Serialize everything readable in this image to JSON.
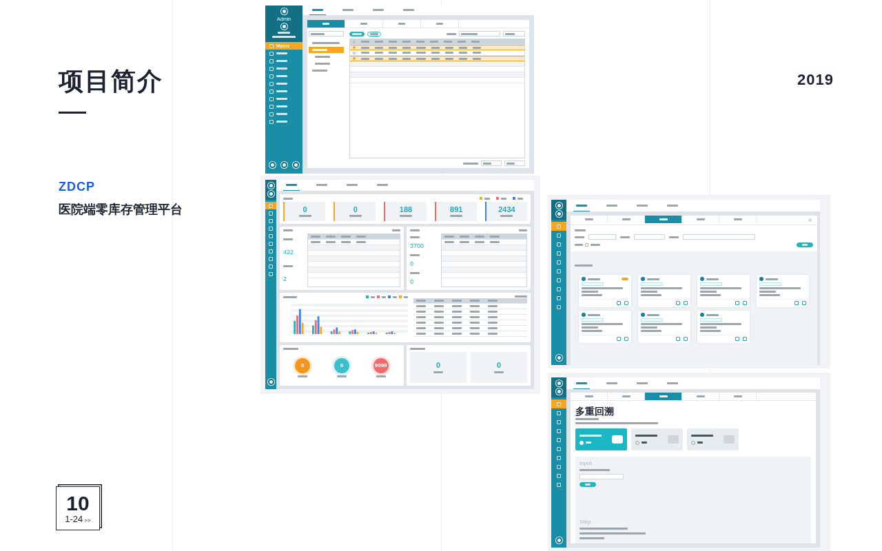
{
  "heading": "项目简介",
  "code": "ZDCP",
  "product": "医院端零库存管理平台",
  "year": "2019",
  "pager": {
    "number": "10",
    "range": "1-24",
    "arrow": ">>"
  },
  "list_screen": {
    "user": "Admin",
    "nav": [
      {
        "label": "Home",
        "selected": true
      },
      {
        "selected": false
      },
      {
        "selected": false
      },
      {
        "selected": false
      },
      {
        "selected": false
      },
      {
        "selected": false
      },
      {
        "selected": false
      },
      {
        "selected": false
      },
      {
        "selected": false
      },
      {
        "selected": false
      },
      {
        "selected": false
      }
    ],
    "tabs": [
      {
        "selected": true
      },
      {
        "selected": false
      },
      {
        "selected": false
      },
      {
        "selected": false
      }
    ],
    "subtabs": [
      {
        "selected": true
      },
      {
        "selected": false
      },
      {
        "selected": false
      },
      {
        "selected": false
      }
    ],
    "tree": [
      {
        "selected": false
      },
      {
        "selected": true
      },
      {
        "selected": false
      },
      {
        "selected": false
      },
      {
        "selected": false
      }
    ],
    "rows": [
      {
        "selected": true
      },
      {
        "selected": false
      },
      {
        "selected": true
      }
    ]
  },
  "dashboard_screen": {
    "nav": [
      {
        "selected": true
      },
      {
        "selected": false
      },
      {
        "selected": false
      },
      {
        "selected": false
      },
      {
        "selected": false
      },
      {
        "selected": false
      },
      {
        "selected": false
      },
      {
        "selected": false
      },
      {
        "selected": false
      },
      {
        "selected": false
      }
    ],
    "tabs": [
      {
        "selected": true
      },
      {
        "selected": false
      },
      {
        "selected": false
      },
      {
        "selected": false
      }
    ],
    "legend": [
      {
        "color": "#f5a623"
      },
      {
        "color": "#f26b6b"
      },
      {
        "color": "#3b82f0"
      }
    ],
    "stats": [
      {
        "value": "0",
        "color": "#f5a623"
      },
      {
        "value": "0",
        "color": "#f5a623"
      },
      {
        "value": "188",
        "color": "#f26b6b"
      },
      {
        "value": "891",
        "color": "#f26b6b"
      },
      {
        "value": "2434",
        "color": "#3b82f0"
      }
    ],
    "left_values": [
      "422",
      "2"
    ],
    "right_values": [
      "3700",
      "0",
      "0"
    ],
    "chart_series": [
      {
        "color": "#26b3b8"
      },
      {
        "color": "#f26b6b"
      },
      {
        "color": "#3b82f0"
      },
      {
        "color": "#f5a623"
      }
    ],
    "circles": [
      {
        "value": "0",
        "color": "#f7941d"
      },
      {
        "value": "0",
        "color": "#3cbfcb"
      },
      {
        "value": "9999",
        "color": "#f26b6b"
      }
    ],
    "tiles": [
      "0",
      "0"
    ]
  },
  "cards_screen": {
    "nav": [
      {
        "selected": true
      },
      {
        "selected": false
      },
      {
        "selected": false
      },
      {
        "selected": false
      },
      {
        "selected": false
      },
      {
        "selected": false
      },
      {
        "selected": false
      },
      {
        "selected": false
      },
      {
        "selected": false
      },
      {
        "selected": false
      }
    ],
    "tabs": [
      {
        "selected": true
      },
      {
        "selected": false
      },
      {
        "selected": false
      },
      {
        "selected": false
      }
    ],
    "subtabs": [
      {
        "selected": false
      },
      {
        "selected": false
      },
      {
        "selected": true
      },
      {
        "selected": false
      },
      {
        "selected": false
      }
    ],
    "filter_checked": false,
    "cards": [
      {
        "tagged": true
      },
      {
        "tagged": false
      },
      {
        "tagged": false
      },
      {
        "tagged": false
      },
      {
        "tagged": false
      },
      {
        "tagged": false
      },
      {
        "tagged": false
      }
    ]
  },
  "trace_screen": {
    "nav": [
      {
        "selected": true
      },
      {
        "selected": false
      },
      {
        "selected": false
      },
      {
        "selected": false
      },
      {
        "selected": false
      },
      {
        "selected": false
      },
      {
        "selected": false
      },
      {
        "selected": false
      },
      {
        "selected": false
      },
      {
        "selected": false
      }
    ],
    "tabs": [
      {
        "selected": true
      },
      {
        "selected": false
      },
      {
        "selected": false
      },
      {
        "selected": false
      }
    ],
    "subtabs": [
      {
        "selected": false
      },
      {
        "selected": false
      },
      {
        "selected": true
      },
      {
        "selected": false
      },
      {
        "selected": false
      }
    ],
    "heading": "多重回溯",
    "options": [
      {
        "selected": true
      },
      {
        "selected": false
      },
      {
        "selected": false
      }
    ],
    "input_label": "Input.",
    "step_label": "Step."
  }
}
